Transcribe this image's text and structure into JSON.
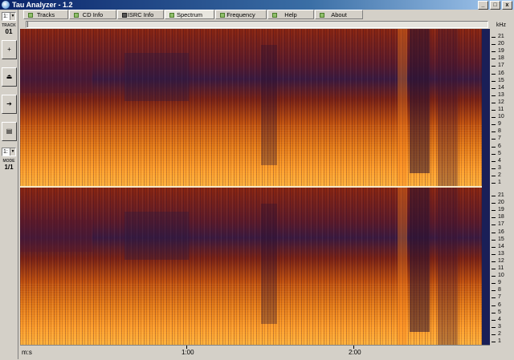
{
  "window": {
    "title": "Tau Analyzer - 1.2"
  },
  "sidebar": {
    "track_combo": "1:",
    "track_label": "TRACK",
    "track_value": "01",
    "mode_combo": "1:",
    "mode_label": "MODE",
    "mode_value": "1/1",
    "buttons": [
      "+",
      "⏏",
      "➔",
      "▤"
    ]
  },
  "tabs": [
    {
      "label": "Tracks",
      "active": false
    },
    {
      "label": "CD Info",
      "active": false
    },
    {
      "label": "ISRC Info",
      "active": false
    },
    {
      "label": "Spectrum",
      "active": true
    },
    {
      "label": "Frequency",
      "active": false
    },
    {
      "label": "Help",
      "active": false
    },
    {
      "label": "About",
      "active": false
    }
  ],
  "frequency_axis": {
    "unit": "kHz",
    "ticks": [
      "21",
      "20",
      "19",
      "18",
      "17",
      "16",
      "15",
      "14",
      "13",
      "12",
      "11",
      "10",
      "9",
      "8",
      "7",
      "6",
      "5",
      "4",
      "3",
      "2",
      "1"
    ]
  },
  "time_axis": {
    "unit": "m:s",
    "ticks": [
      "1:00",
      "2:00"
    ]
  },
  "colors": {
    "spectrum_dark": "#2a1a4a",
    "spectrum_mid": "#a2310f",
    "spectrum_hot": "#ff9a2a",
    "scrollbar": "#1a1f57"
  }
}
